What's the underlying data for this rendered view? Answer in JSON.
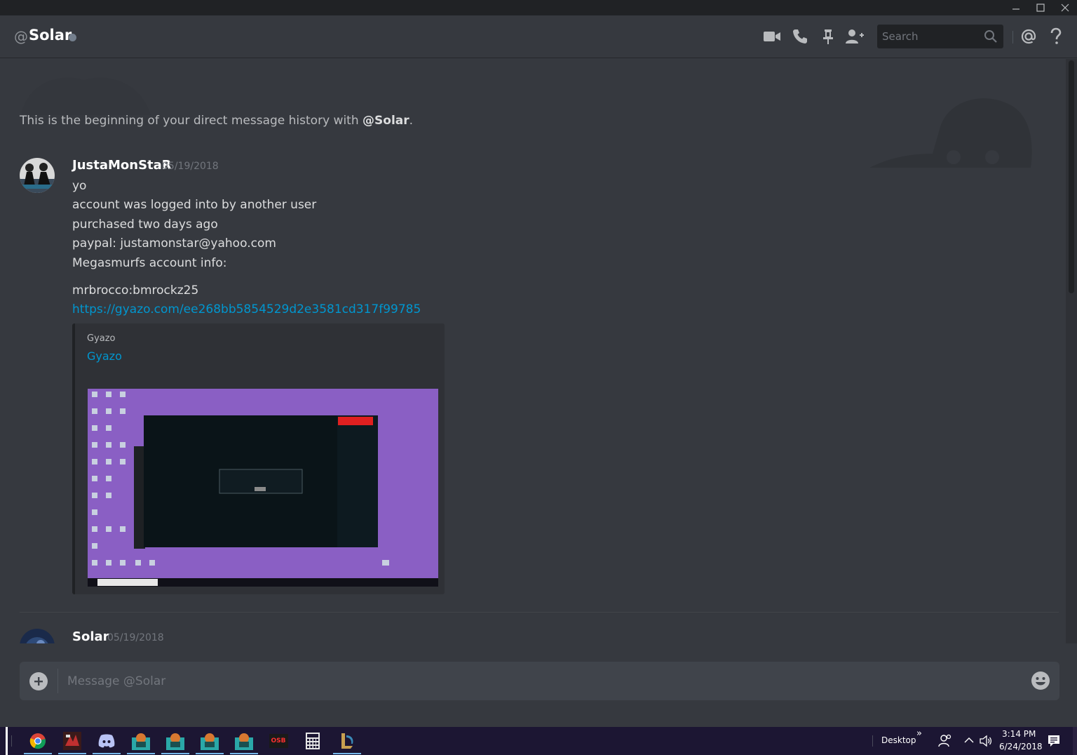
{
  "header": {
    "at": "@",
    "channel_name": "Solar",
    "search_placeholder": "Search"
  },
  "intro": {
    "prefix": "This is the beginning of your direct message history with ",
    "mention": "@Solar",
    "suffix": "."
  },
  "messages": [
    {
      "author": "JustaMonStaR",
      "timestamp": "05/19/2018",
      "lines": [
        "yo",
        "account was logged into by another user",
        "purchased two days ago",
        "paypal: justamonstar@yahoo.com",
        "Megasmurfs account info:",
        "mrbrocco:bmrockz25"
      ],
      "link": "https://gyazo.com/ee268bb5854529d2e3581cd317f99785",
      "embed": {
        "provider": "Gyazo",
        "title": "Gyazo"
      }
    },
    {
      "author": "Solar",
      "timestamp": "05/19/2018"
    }
  ],
  "composer": {
    "placeholder": "Message @Solar"
  },
  "taskbar": {
    "desktop_label": "Desktop",
    "chevron": "»",
    "time": "3:14 PM",
    "date": "6/24/2018",
    "osb_label": "OSB"
  },
  "colors": {
    "background": "#36393f",
    "link": "#0096cf",
    "taskbar": "#1c1633",
    "embed_image_bg": "#8a5fc4"
  }
}
